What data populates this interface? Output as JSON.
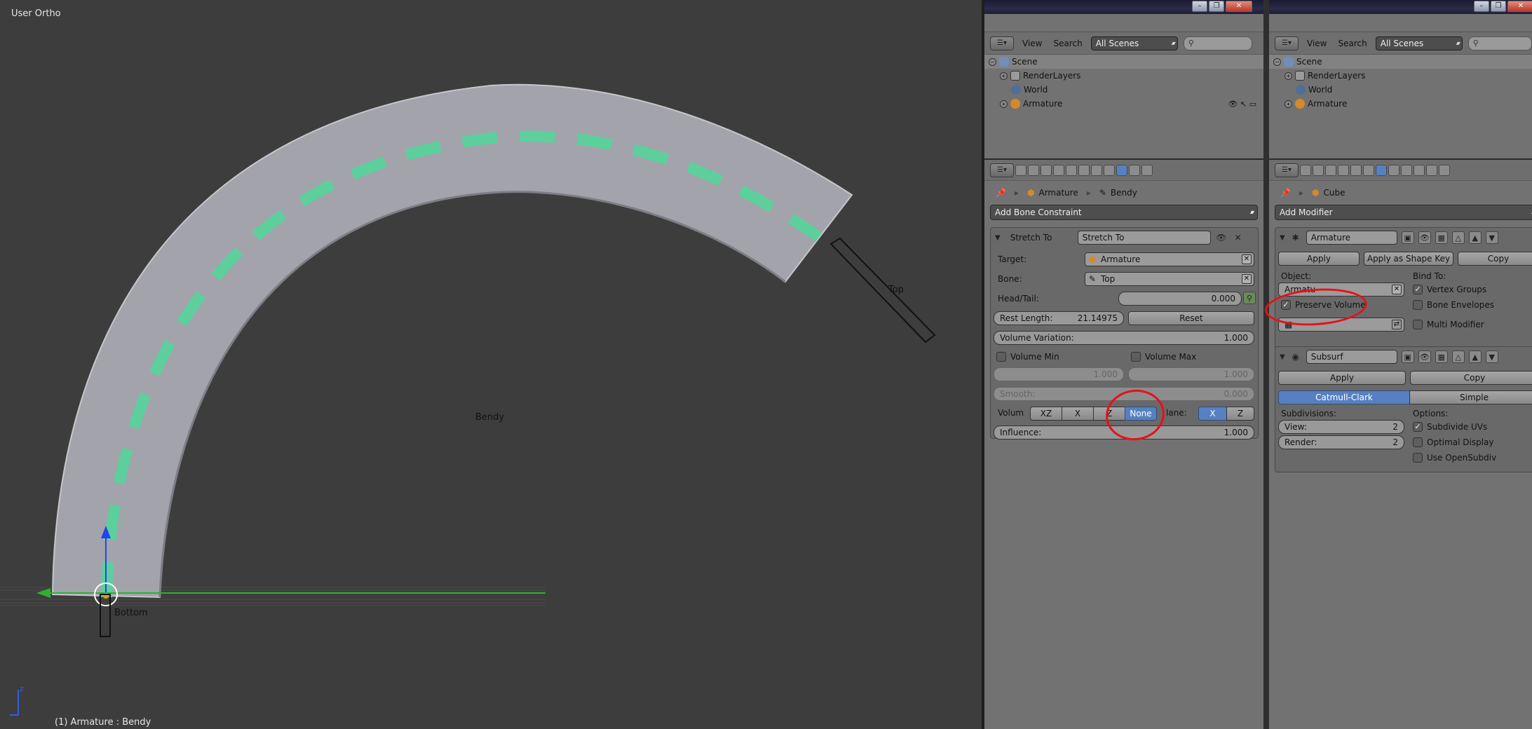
{
  "viewport": {
    "title": "User Ortho",
    "status": "(1) Armature : Bendy",
    "labels": {
      "bendy": "Bendy",
      "top": "Top",
      "bottom": "Bottom"
    },
    "colors": {
      "background": "#3d3d3d",
      "mesh": "#a3a3ab",
      "edges": "#5ccf9c",
      "grid": "#2fb12f"
    }
  },
  "window_controls": [
    "–",
    "❐",
    "✕"
  ],
  "outliner_left": {
    "menu": [
      "View",
      "Search"
    ],
    "scene_select": "All Scenes",
    "items": [
      "Scene",
      "RenderLayers",
      "World",
      "Armature"
    ]
  },
  "outliner_right": {
    "menu": [
      "View",
      "Search"
    ],
    "scene_select": "All Scenes",
    "items": [
      "Scene",
      "RenderLayers",
      "World",
      "Armature"
    ]
  },
  "bone_constraints": {
    "breadcrumb": [
      "Armature",
      "Bendy"
    ],
    "add_label": "Add Bone Constraint",
    "constraint": {
      "type": "Stretch To",
      "name": "Stretch To",
      "target_label": "Target:",
      "target": "Armature",
      "bone_label": "Bone:",
      "bone": "Top",
      "head_tail_label": "Head/Tail:",
      "head_tail": "0.000",
      "rest_length_label": "Rest Length:",
      "rest_length": "21.14975",
      "reset_label": "Reset",
      "volume_variation_label": "Volume Variation:",
      "volume_variation": "1.000",
      "volume_min_label": "Volume Min",
      "volume_min": "1.000",
      "volume_max_label": "Volume Max",
      "volume_max": "1.000",
      "smooth_label": "Smooth:",
      "smooth": "0.000",
      "volume_label": "Volum",
      "volume_options": [
        "XZ",
        "X",
        "Z",
        "None"
      ],
      "volume_selected": "None",
      "plane_label": "lane:",
      "plane_options": [
        "X",
        "Z"
      ],
      "plane_selected": "X",
      "influence_label": "Influence:",
      "influence": "1.000"
    }
  },
  "modifiers": {
    "breadcrumb": [
      "Cube"
    ],
    "add_label": "Add Modifier",
    "armature_mod": {
      "name": "Armature",
      "apply_label": "Apply",
      "apply_shape_label": "Apply as Shape Key",
      "copy_label": "Copy",
      "object_label": "Object:",
      "object": "Armatu",
      "bind_to_label": "Bind To:",
      "vertex_groups_label": "Vertex Groups",
      "vertex_groups": true,
      "bone_envelopes_label": "Bone Envelopes",
      "bone_envelopes": false,
      "preserve_volume_label": "Preserve Volume",
      "preserve_volume": true,
      "multi_modifier_label": "Multi Modifier",
      "multi_modifier": false
    },
    "subsurf_mod": {
      "name": "Subsurf",
      "apply_label": "Apply",
      "copy_label": "Copy",
      "algorithms": [
        "Catmull-Clark",
        "Simple"
      ],
      "algorithm_selected": "Catmull-Clark",
      "subdivisions_label": "Subdivisions:",
      "view_label": "View:",
      "view": "2",
      "render_label": "Render:",
      "render": "2",
      "options_label": "Options:",
      "subdivide_uvs_label": "Subdivide UVs",
      "subdivide_uvs": true,
      "optimal_display_label": "Optimal Display",
      "optimal_display": false,
      "use_opensubdiv_label": "Use OpenSubdiv",
      "use_opensubdiv": false
    }
  }
}
